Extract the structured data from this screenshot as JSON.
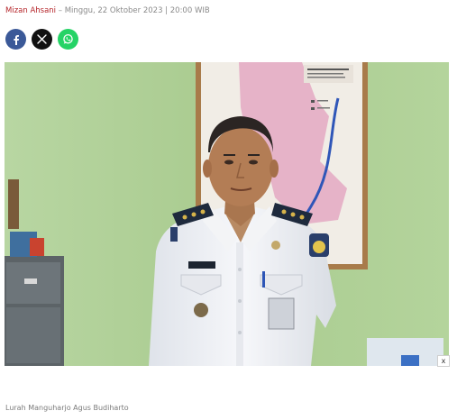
{
  "article": {
    "author": "Mizan Ahsani",
    "date_line": " – Minggu, 22 Oktober 2023 | 20:00 WIB",
    "caption": "Lurah Manguharjo Agus Budiharto"
  },
  "share": [
    {
      "icon": "facebook-icon",
      "color": "#3b5998"
    },
    {
      "icon": "x-icon",
      "color": "#111111"
    },
    {
      "icon": "whatsapp-icon",
      "color": "#25d366"
    }
  ],
  "ad": {
    "close_label": "x"
  },
  "colors": {
    "author": "#b5252a",
    "wall": "#a6c98a"
  }
}
